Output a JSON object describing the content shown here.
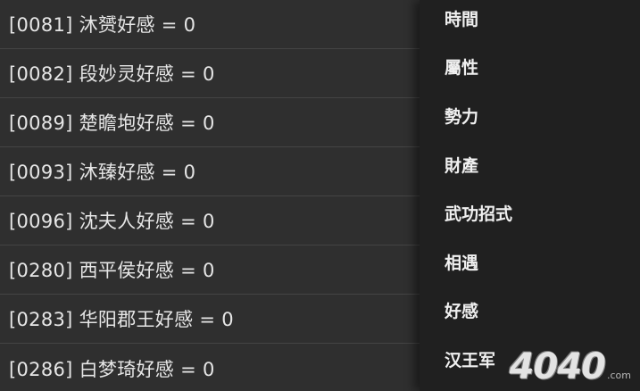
{
  "list": {
    "items": [
      {
        "label": "[0081] 沐赟好感 = 0"
      },
      {
        "label": "[0082] 段妙灵好感 = 0"
      },
      {
        "label": "[0089] 楚瞻垉好感 = 0"
      },
      {
        "label": "[0093] 沐臻好感 = 0"
      },
      {
        "label": "[0096] 沈夫人好感 = 0"
      },
      {
        "label": "[0280] 西平侯好感 = 0"
      },
      {
        "label": "[0283] 华阳郡王好感 = 0"
      },
      {
        "label": "[0286] 白梦琦好感 = 0"
      }
    ]
  },
  "menu": {
    "items": [
      {
        "label": "時間"
      },
      {
        "label": "屬性"
      },
      {
        "label": "勢力"
      },
      {
        "label": "財產"
      },
      {
        "label": "武功招式"
      },
      {
        "label": "相遇"
      },
      {
        "label": "好感"
      },
      {
        "label": "汉王军"
      }
    ]
  },
  "watermark": {
    "text": "4040",
    "suffix": ".com"
  },
  "colors": {
    "list_bg": "#2f2f2f",
    "menu_bg": "#202020",
    "text": "#e6e6e6",
    "divider": "#444444"
  }
}
